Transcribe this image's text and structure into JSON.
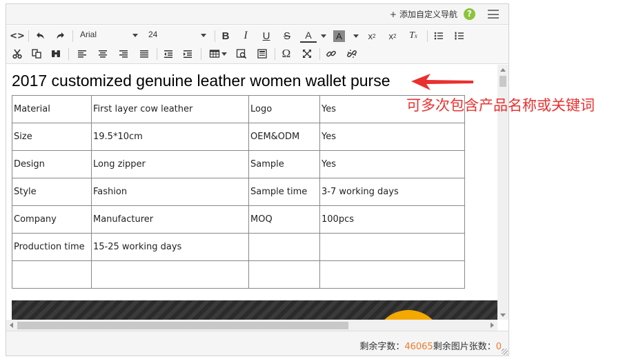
{
  "topbar": {
    "nav_plus": "+",
    "nav_label": "添加自定义导航",
    "help_icon": "question-icon",
    "help_glyph": "?",
    "menu_icon": "hamburger-icon"
  },
  "toolbar": {
    "font_family": "Arial",
    "font_size": "24",
    "icons": [
      "source-icon",
      "undo-icon",
      "redo-icon",
      "bold-icon",
      "italic-icon",
      "underline-icon",
      "strikethrough-icon",
      "font-color-icon",
      "background-color-icon",
      "superscript-icon",
      "subscript-icon",
      "clear-format-icon",
      "bullet-list-icon",
      "numbered-list-icon",
      "cut-icon",
      "copy-icon",
      "find-icon",
      "align-left-icon",
      "align-center-icon",
      "align-right-icon",
      "justify-icon",
      "outdent-icon",
      "indent-icon",
      "table-icon",
      "preview-icon",
      "template-icon",
      "special-char-icon",
      "fullscreen-icon",
      "link-icon",
      "unlink-icon"
    ],
    "glyphs": {
      "source": "<>",
      "bold": "B",
      "italic": "I",
      "underline": "U",
      "strike": "S",
      "font_color": "A",
      "bg_color": "A",
      "superscript_base": "x",
      "superscript_exp": "2",
      "subscript_base": "x",
      "subscript_exp": "2",
      "clear_format": "T",
      "clear_format_sub": "x",
      "omega": "Ω"
    }
  },
  "content": {
    "title": "2017 customized genuine leather women wallet purse",
    "table": [
      [
        "Material",
        "First layer cow leather",
        "Logo",
        "Yes"
      ],
      [
        "Size",
        "19.5*10cm",
        "OEM&ODM",
        "Yes"
      ],
      [
        "Design",
        "Long zipper",
        "Sample",
        "Yes"
      ],
      [
        "Style",
        "Fashion",
        "Sample time",
        "3-7 working days"
      ],
      [
        "Company",
        "Manufacturer",
        "MOQ",
        "100pcs"
      ],
      [
        "Production time",
        "15-25 working days",
        "",
        ""
      ],
      [
        "",
        "",
        "",
        ""
      ]
    ]
  },
  "status": {
    "chars_label": "剩余字数：",
    "chars_value": "46065",
    "images_label": "剩余图片张数：",
    "images_value": "0"
  },
  "annotation": {
    "text": "可多次包含产品名称或关键词",
    "color": "#e8312f"
  },
  "colors": {
    "accent_orange": "#f07a2a",
    "help_green": "#8cc43c",
    "banner_yellow": "#f5a800"
  }
}
